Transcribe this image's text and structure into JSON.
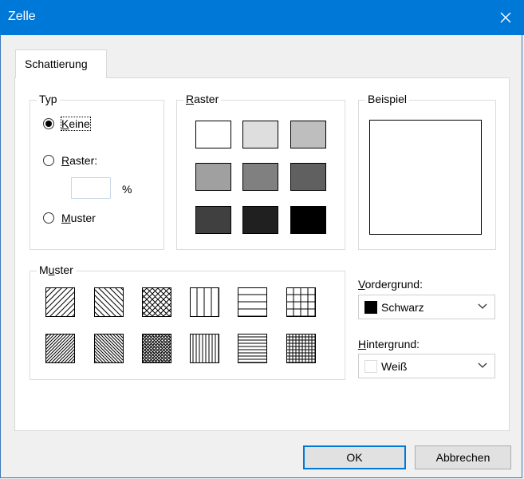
{
  "window": {
    "title": "Zelle",
    "close_label": "close"
  },
  "tab": {
    "label": "Schattierung"
  },
  "typ": {
    "title": "Typ",
    "options": [
      {
        "accel": "K",
        "rest": "eine",
        "selected": true
      },
      {
        "accel": "R",
        "rest": "aster:",
        "selected": false
      },
      {
        "accel": "M",
        "rest": "uster",
        "selected": false
      }
    ],
    "percent_value": "",
    "percent_sign": "%"
  },
  "raster": {
    "title_accel": "R",
    "title_rest": "aster",
    "swatches": [
      "#ffffff",
      "#dedede",
      "#bebebe",
      "#a0a0a0",
      "#808080",
      "#606060",
      "#404040",
      "#202020",
      "#000000"
    ]
  },
  "beispiel": {
    "title": "Beispiel",
    "fill": "#ffffff"
  },
  "muster": {
    "title_pre": "M",
    "title_accel": "u",
    "title_rest": "ster",
    "patterns": [
      "wide-diagonal-up",
      "wide-diagonal-down",
      "wide-diagonal-cross",
      "wide-vertical",
      "wide-horizontal",
      "wide-grid",
      "dense-diagonal-up",
      "dense-diagonal-down",
      "dense-diagonal-cross",
      "dense-vertical",
      "dense-horizontal",
      "dense-grid"
    ]
  },
  "vordergrund": {
    "accel": "V",
    "rest": "ordergrund:",
    "value": "Schwarz",
    "color": "#000000"
  },
  "hintergrund": {
    "accel": "H",
    "rest": "intergrund:",
    "value": "Weiß",
    "color": "#ffffff"
  },
  "buttons": {
    "ok": "OK",
    "cancel": "Abbrechen"
  }
}
